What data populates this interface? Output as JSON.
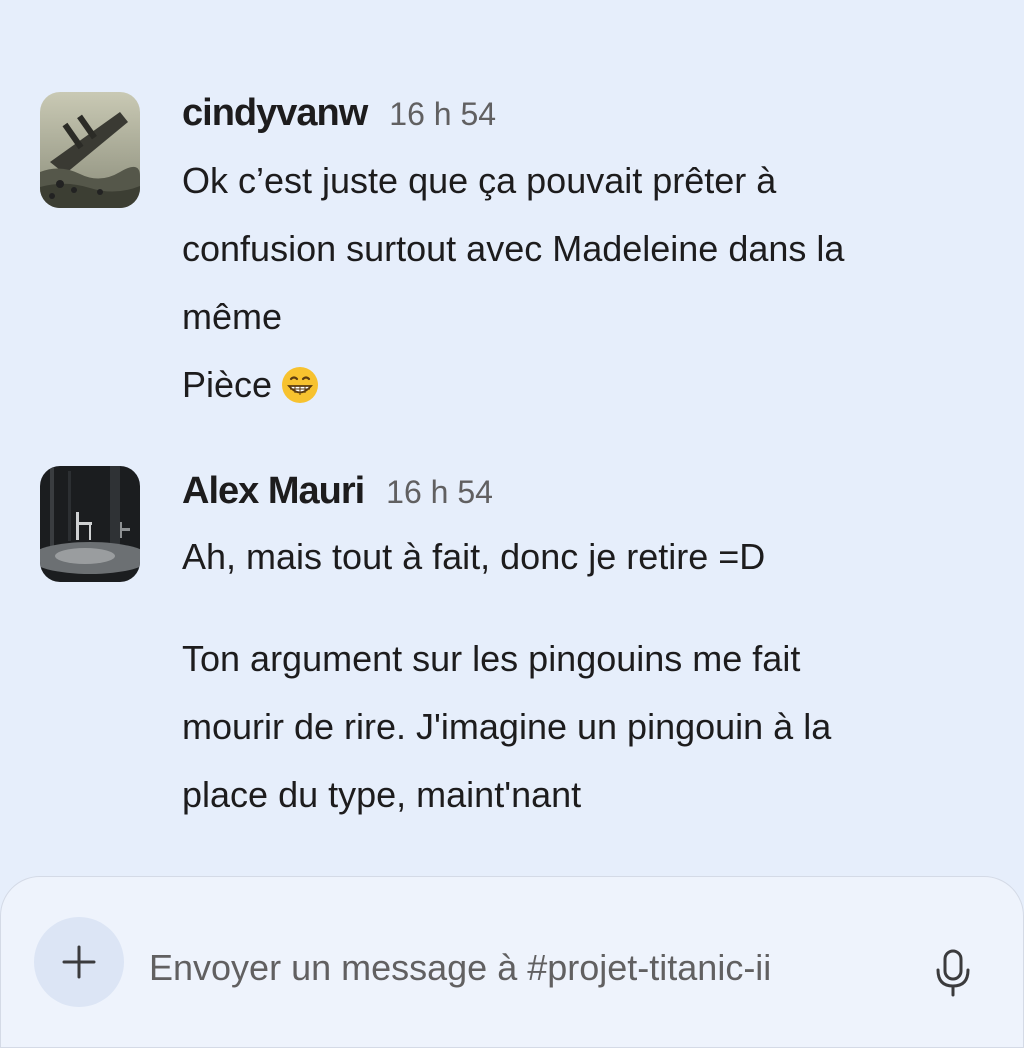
{
  "messages": [
    {
      "username": "cindyvanw",
      "timestamp": "16 h 54",
      "avatar": "titanic-sinking-illustration",
      "lines": [
        "Ok c’est juste que ça pouvait prêter à",
        "confusion surtout avec Madeleine dans la",
        "même",
        "Pièce"
      ],
      "emoji": "grinning-face-emoji"
    },
    {
      "username": "Alex Mauri",
      "timestamp": "16 h 54",
      "avatar": "empty-stage-chair-photo",
      "lines": [
        "Ah, mais tout à fait, donc je retire =D",
        "Ton argument sur les pingouins me fait",
        "mourir de rire. J'imagine un pingouin à la",
        "place du type, maint'nant"
      ]
    }
  ],
  "composer": {
    "placeholder": "Envoyer un message à #projet-titanic-ii",
    "add_icon": "plus-icon",
    "mic_icon": "microphone-icon"
  },
  "colors": {
    "background": "#e6eefb",
    "text": "#1d1c1d",
    "muted": "#616061"
  }
}
